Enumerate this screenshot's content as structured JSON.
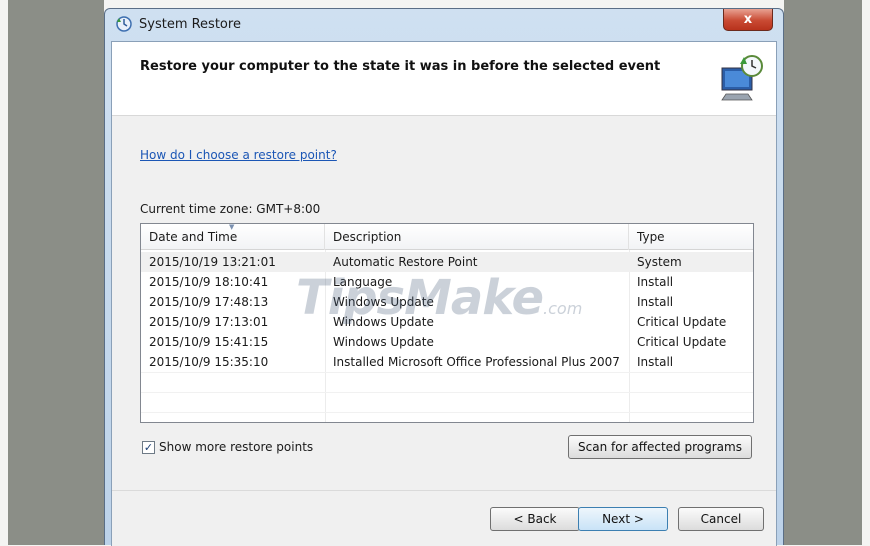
{
  "window": {
    "title": "System Restore",
    "close_glyph": "x"
  },
  "header": {
    "title": "Restore your computer to the state it was in before the selected event",
    "icon": "restore-computer-icon"
  },
  "help_link": "How do I choose a restore point?",
  "timezone_label": "Current time zone: GMT+8:00",
  "table": {
    "columns": [
      "Date and Time",
      "Description",
      "Type"
    ],
    "rows": [
      {
        "date": "2015/10/19 13:21:01",
        "description": "Automatic Restore Point",
        "type": "System"
      },
      {
        "date": "2015/10/9 18:10:41",
        "description": "Language",
        "type": "Install"
      },
      {
        "date": "2015/10/9 17:48:13",
        "description": "Windows Update",
        "type": "Install"
      },
      {
        "date": "2015/10/9 17:13:01",
        "description": "Windows Update",
        "type": "Critical Update"
      },
      {
        "date": "2015/10/9 15:41:15",
        "description": "Windows Update",
        "type": "Critical Update"
      },
      {
        "date": "2015/10/9 15:35:10",
        "description": "Installed Microsoft Office Professional Plus 2007",
        "type": "Install"
      }
    ]
  },
  "watermark": {
    "main": "TipsMake",
    "suffix": ".com"
  },
  "show_more": {
    "label": "Show more restore points",
    "checked": true
  },
  "buttons": {
    "scan": "Scan for affected programs",
    "back": "< Back",
    "next": "Next >",
    "cancel": "Cancel"
  }
}
